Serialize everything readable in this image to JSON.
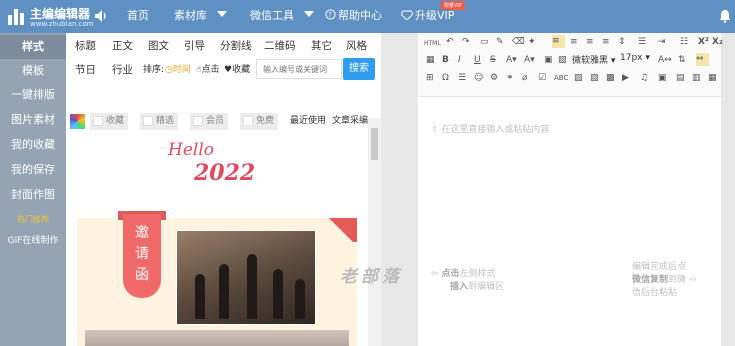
{
  "topbar": {
    "logo_title": "主编编辑器",
    "logo_subtitle": "www.zhubian.com",
    "nav": [
      "首页",
      "素材库",
      "微信工具",
      "帮助中心",
      "升级VIP"
    ],
    "vip_badge": "限量VIP"
  },
  "sidebar": {
    "items": [
      "样式",
      "模板",
      "一键排版",
      "图片素材",
      "我的收藏",
      "我的保存",
      "封面作图",
      "热门推荐",
      "GIF在线制作"
    ]
  },
  "panel": {
    "categories_row1": [
      "标题",
      "正文",
      "图文",
      "引导",
      "分割线",
      "二维码",
      "其它",
      "风格"
    ],
    "categories_row2": [
      "节日",
      "行业"
    ],
    "sort_label": "排序:",
    "sort_options": [
      "时间",
      "点击",
      "收藏"
    ],
    "search_placeholder": "输入编号或关键词",
    "search_button": "搜索",
    "filters": [
      "收藏",
      "精选",
      "会员",
      "免费"
    ],
    "recent": "最近使用",
    "article_collect": "文章采编",
    "preview": {
      "hello": "Hello",
      "year": "2022",
      "invite": [
        "邀",
        "请",
        "函"
      ]
    }
  },
  "editor": {
    "toolbar_row1": [
      "HTML",
      "B",
      "I",
      "U",
      "S",
      "X²",
      "X₂"
    ],
    "toolbar_row2": [
      "ABC"
    ],
    "font_family": "微软雅黑",
    "font_size": "17px",
    "hint_top": "在这里直接输入或粘贴内容",
    "hint_left_1": "点击",
    "hint_left_2": "左侧样式",
    "hint_left_3": "插入",
    "hint_left_4": "到编辑区",
    "hint_right_1": "编辑完成后点",
    "hint_right_2a": "微信复制",
    "hint_right_2b": "到微",
    "hint_right_3": "信后台粘贴"
  },
  "watermark": "老部落",
  "colors": {
    "topbar": "#5f90c4",
    "sidebar": "#95a4b4",
    "accent_blue": "#2f9cee",
    "accent_red": "#e04a5e"
  }
}
